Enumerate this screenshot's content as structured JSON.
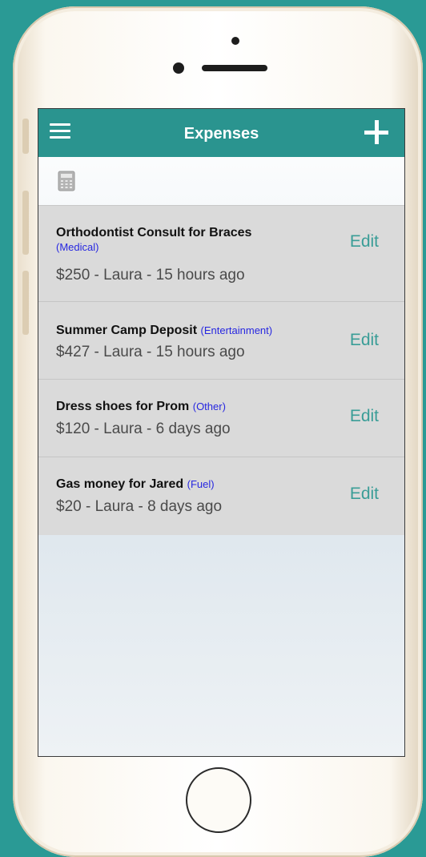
{
  "app": {
    "title": "Expenses"
  },
  "icons": {
    "menu": "menu-icon",
    "add": "plus-icon",
    "calculator": "calculator-icon"
  },
  "colors": {
    "background": "#2a9a95",
    "navbar": "#2a948f",
    "edit_link": "#3a9d97",
    "category": "#2727e0",
    "list_background": "#dadada"
  },
  "expenses": [
    {
      "title": "Orthodontist Consult for Braces",
      "category": "(Medical)",
      "meta": "$250 - Laura - 15 hours ago",
      "edit_label": "Edit"
    },
    {
      "title": "Summer Camp Deposit",
      "category": "(Entertainment)",
      "meta": "$427 - Laura - 15 hours ago",
      "edit_label": "Edit"
    },
    {
      "title": "Dress shoes for Prom",
      "category": "(Other)",
      "meta": "$120 - Laura - 6 days ago",
      "edit_label": "Edit"
    },
    {
      "title": "Gas money for Jared",
      "category": "(Fuel)",
      "meta": "$20 - Laura - 8 days ago",
      "edit_label": "Edit"
    }
  ]
}
